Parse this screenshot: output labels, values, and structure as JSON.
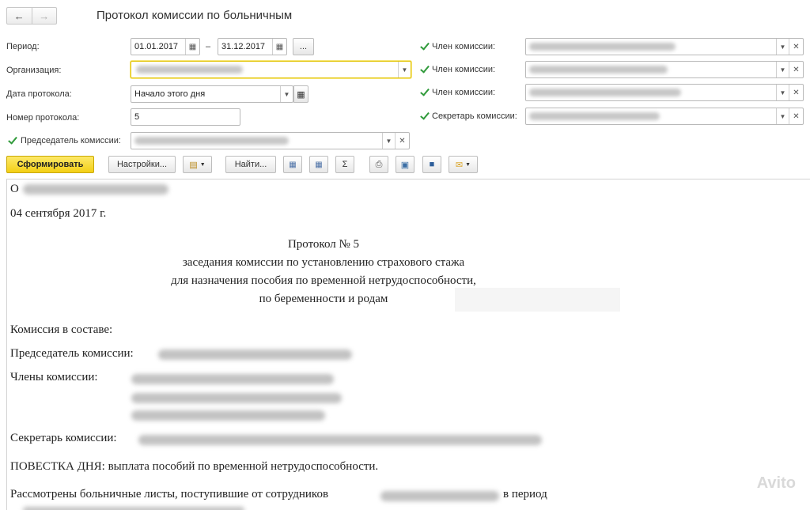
{
  "window": {
    "title": "Протокол комиссии по больничным",
    "nav_back": "←",
    "nav_forward": "→"
  },
  "form": {
    "period_label": "Период:",
    "period_from": "01.01.2017",
    "period_dash": "–",
    "period_to": "31.12.2017",
    "period_more": "...",
    "org_label": "Организация:",
    "date_label": "Дата протокола:",
    "date_value": "Начало этого дня",
    "number_label": "Номер протокола:",
    "number_value": "5",
    "chairman_label": "Председатель комиссии:",
    "member1_label": "Член комиссии:",
    "member2_label": "Член комиссии:",
    "member3_label": "Член комиссии:",
    "secretary_label": "Секретарь комиссии:"
  },
  "toolbar": {
    "generate": "Сформировать",
    "settings": "Настройки...",
    "find": "Найти...",
    "sum": "Σ"
  },
  "document": {
    "org_prefix": "О",
    "date": "04 сентября 2017  г.",
    "heading1": "Протокол №  5",
    "heading2": "заседания комиссии по установлению страхового стажа",
    "heading3": "для назначения пособия по временной нетрудоспособности,",
    "heading4": "по беременности и родам",
    "composition": "Комиссия в составе:",
    "chairman": "Председатель комиссии:",
    "members": "Члены комиссии:",
    "secretary": "Секретарь комиссии:",
    "agenda": "ПОВЕСТКА  ДНЯ:  выплата пособий по временной нетрудоспособности.",
    "reviewed": "Рассмотрены больничные листы, поступившие от сотрудников",
    "period_suffix": "в период"
  },
  "watermark": "Avito",
  "colors": {
    "primary_button": "#f3cf15",
    "checkbox": "#2f9a3a",
    "focus_border": "#e2c300"
  }
}
